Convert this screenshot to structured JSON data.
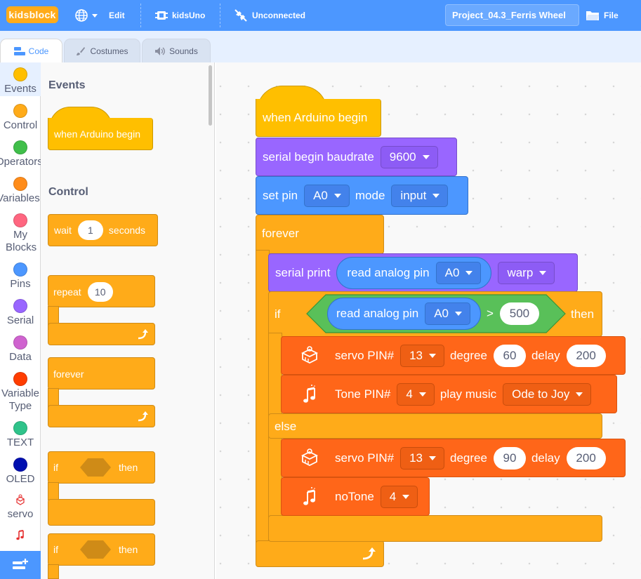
{
  "topbar": {
    "logo": "kidsblock",
    "edit": "Edit",
    "device": "kidsUno",
    "connection": "Unconnected",
    "project_name": "Project_04.3_Ferris Wheel",
    "file": "File"
  },
  "tabs": [
    {
      "label": "Code",
      "selected": true
    },
    {
      "label": "Costumes",
      "selected": false
    },
    {
      "label": "Sounds",
      "selected": false
    }
  ],
  "categories": [
    {
      "label": "Events",
      "color": "#ffbf00"
    },
    {
      "label": "Control",
      "color": "#ffab19"
    },
    {
      "label": "Operators",
      "color": "#40bf4a"
    },
    {
      "label": "Variables",
      "color": "#ff8c1a"
    },
    {
      "label": "My Blocks",
      "color": "#ff6680"
    },
    {
      "label": "Pins",
      "color": "#4c97ff"
    },
    {
      "label": "Serial",
      "color": "#9966ff"
    },
    {
      "label": "Data",
      "color": "#cf63cf"
    },
    {
      "label": "Variable Type",
      "color": "#ff3d00"
    },
    {
      "label": "TEXT",
      "color": "#2fc38a"
    },
    {
      "label": "OLED",
      "color": "#000fb0"
    },
    {
      "label": "servo",
      "icon": "servo-icon"
    },
    {
      "label": "",
      "icon": "music-note-icon"
    }
  ],
  "palette": {
    "events_heading": "Events",
    "when_arduino_begin": "when Arduino begin",
    "control_heading": "Control",
    "wait_label": "wait",
    "wait_value": "1",
    "wait_unit": "seconds",
    "repeat_label": "repeat",
    "repeat_value": "10",
    "forever_label": "forever",
    "if_label": "if",
    "then_label": "then"
  },
  "script": {
    "hat": "when Arduino begin",
    "serial_begin": {
      "label": "serial begin baudrate",
      "value": "9600"
    },
    "set_pin": {
      "label": "set pin",
      "pin": "A0",
      "mode_label": "mode",
      "mode": "input"
    },
    "forever": "forever",
    "serial_print": {
      "label": "serial print",
      "inner_label": "read analog pin",
      "pin": "A0",
      "option": "warp"
    },
    "if": {
      "if_label": "if",
      "inner_label": "read analog pin",
      "pin": "A0",
      "operator": ">",
      "value": "500",
      "then_label": "then"
    },
    "servo1": {
      "label": "servo PIN#",
      "pin": "13",
      "degree_label": "degree",
      "degree": "60",
      "delay_label": "delay",
      "delay": "200"
    },
    "tone": {
      "label": "Tone PIN#",
      "pin": "4",
      "play_label": "play music",
      "song": "Ode to Joy"
    },
    "else": "else",
    "servo2": {
      "label": "servo PIN#",
      "pin": "13",
      "degree_label": "degree",
      "degree": "90",
      "delay_label": "delay",
      "delay": "200"
    },
    "notone": {
      "label": "noTone",
      "pin": "4"
    }
  }
}
